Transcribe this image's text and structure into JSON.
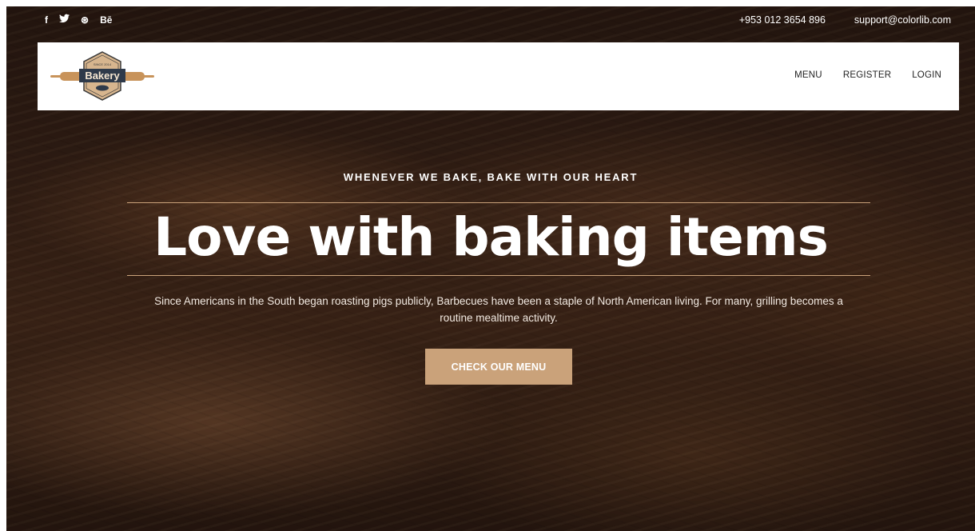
{
  "topbar": {
    "social": [
      {
        "icon": "facebook-icon",
        "glyph": "f"
      },
      {
        "icon": "twitter-icon",
        "glyph": "🐦︎"
      },
      {
        "icon": "dribbble-icon",
        "glyph": "⊛"
      },
      {
        "icon": "behance-icon",
        "glyph": "Bē"
      }
    ],
    "phone": "+953 012 3654 896",
    "email": "support@colorlib.com"
  },
  "header": {
    "logo_text": "Bakery",
    "logo_small_text": "SINCE 2014",
    "nav": [
      "MENU",
      "REGISTER",
      "LOGIN"
    ]
  },
  "hero": {
    "subtitle": "WHENEVER WE BAKE, BAKE WITH OUR HEART",
    "title": "Love with baking items",
    "description": "Since Americans in the South began roasting pigs publicly, Barbecues have been a staple of North American living. For many, grilling becomes a routine mealtime activity.",
    "button_label": "CHECK OUR MENU"
  },
  "colors": {
    "accent": "#caa27a",
    "header_bg": "#ffffff",
    "text_light": "#ffffff"
  }
}
